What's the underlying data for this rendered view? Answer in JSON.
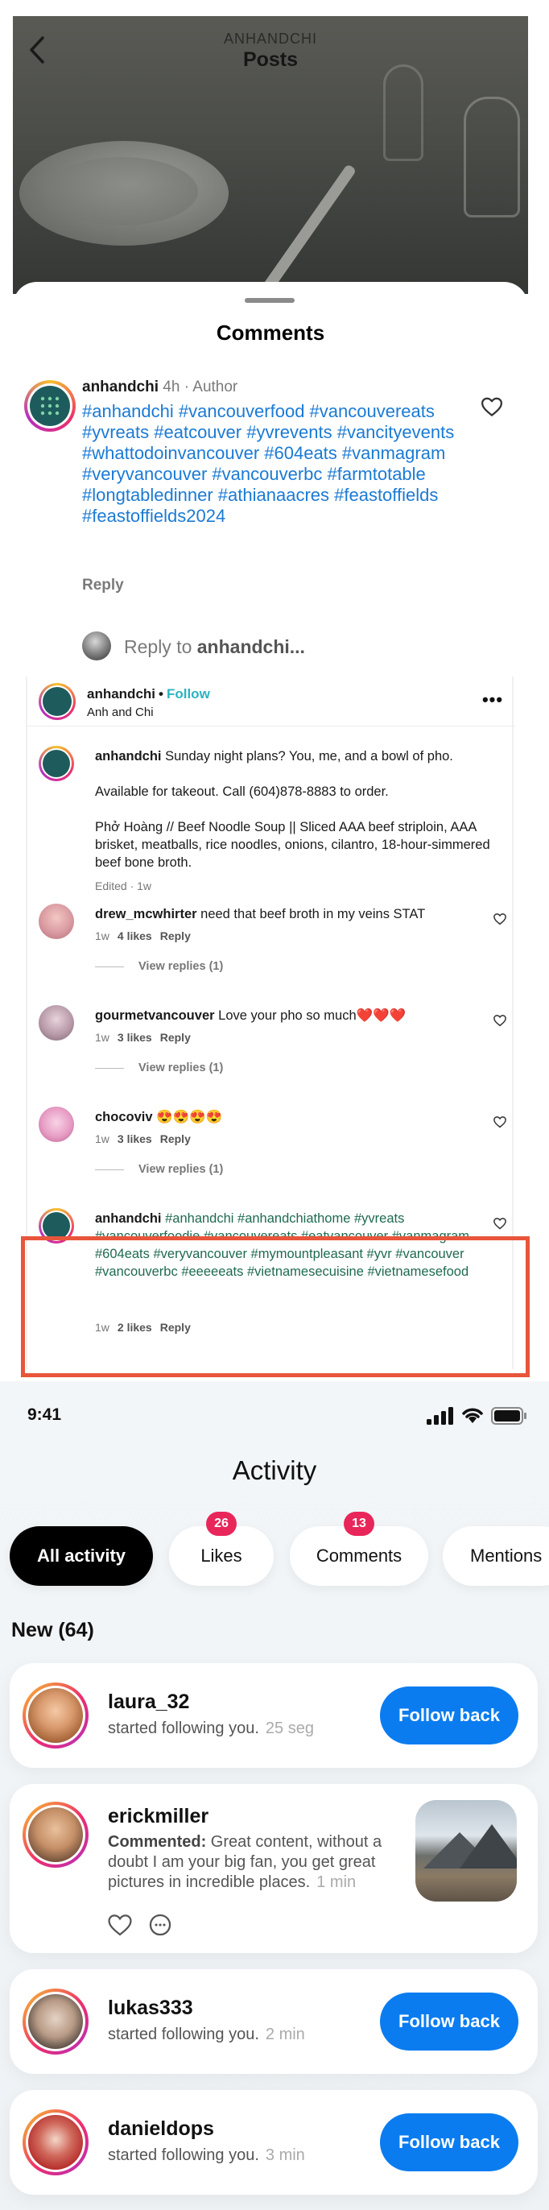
{
  "posts_header": {
    "account": "ANHANDCHI",
    "title": "Posts"
  },
  "sheet": {
    "title": "Comments"
  },
  "author_comment": {
    "username": "anhandchi",
    "time": "4h",
    "role": "Author",
    "text": "#anhandchi #vancouverfood #vancouvereats #yvreats #eatcouver #yvrevents #vancityevents #whattodoinvancouver #604eats #vanmagram #veryvancouver #vancouverbc #farmtotable #longtabledinner #athianaacres #feastoffields #feastoffields2024",
    "reply": "Reply"
  },
  "reply_box": {
    "prefix": "Reply to ",
    "target": "anhandchi..."
  },
  "post_card": {
    "username": "anhandchi",
    "follow": "Follow",
    "subtitle": "Anh and Chi",
    "more": "•••",
    "caption": {
      "username": "anhandchi",
      "line1": "Sunday night plans? You, me, and a bowl of pho.",
      "line2": "Available for takeout. Call (604)878-8883 to order.",
      "line3": "Phở Hoàng // Beef Noodle Soup || Sliced AAA beef striploin, AAA brisket, meatballs, rice noodles, onions, cilantro, 18-hour-simmered beef bone broth.",
      "meta": "Edited · 1w"
    },
    "comments": [
      {
        "username": "drew_mcwhirter",
        "text": "need that beef broth in my veins STAT",
        "time": "1w",
        "likes": "4 likes",
        "reply": "Reply",
        "view_replies": "View replies (1)"
      },
      {
        "username": "gourmetvancouver",
        "text": "Love your pho so much❤️❤️❤️",
        "time": "1w",
        "likes": "3 likes",
        "reply": "Reply",
        "view_replies": "View replies (1)"
      },
      {
        "username": "chocoviv",
        "text": "😍😍😍😍",
        "time": "1w",
        "likes": "3 likes",
        "reply": "Reply",
        "view_replies": "View replies (1)"
      },
      {
        "username": "anhandchi",
        "text": "#anhandchi #anhandchiathome #yvreats #vancouverfoodie #vancouvereats #eatvancouver #vanmagram #604eats #veryvancouver #mymountpleasant #yvr #vancouver #vancouverbc #eeeeeats #vietnamesecuisine #vietnamesefood",
        "time": "1w",
        "likes": "2 likes",
        "reply": "Reply"
      }
    ]
  },
  "activity": {
    "status_time": "9:41",
    "title": "Activity",
    "chips": [
      {
        "label": "All activity",
        "badge": ""
      },
      {
        "label": "Likes",
        "badge": "26"
      },
      {
        "label": "Comments",
        "badge": "13"
      },
      {
        "label": "Mentions",
        "badge": ""
      }
    ],
    "section_label": "New (64)",
    "items": [
      {
        "name": "laura_32",
        "text": "started following you.",
        "time": "25 seg",
        "button": "Follow back"
      },
      {
        "name": "erickmiller",
        "prefix": "Commented:",
        "text": "Great content, without a doubt I am your big fan, you get great pictures in incredible places.",
        "time": "1 min"
      },
      {
        "name": "lukas333",
        "text": "started following you.",
        "time": "2 min",
        "button": "Follow back"
      },
      {
        "name": "danieldops",
        "text": "started following you.",
        "time": "3 min",
        "button": "Follow back"
      }
    ]
  },
  "colors": {
    "hashtag_blue": "#1a7ad4",
    "follow_teal": "#2bb3c2",
    "highlight": "#e8553b",
    "badge": "#e8265a",
    "follow_back": "#0a7cf0"
  }
}
